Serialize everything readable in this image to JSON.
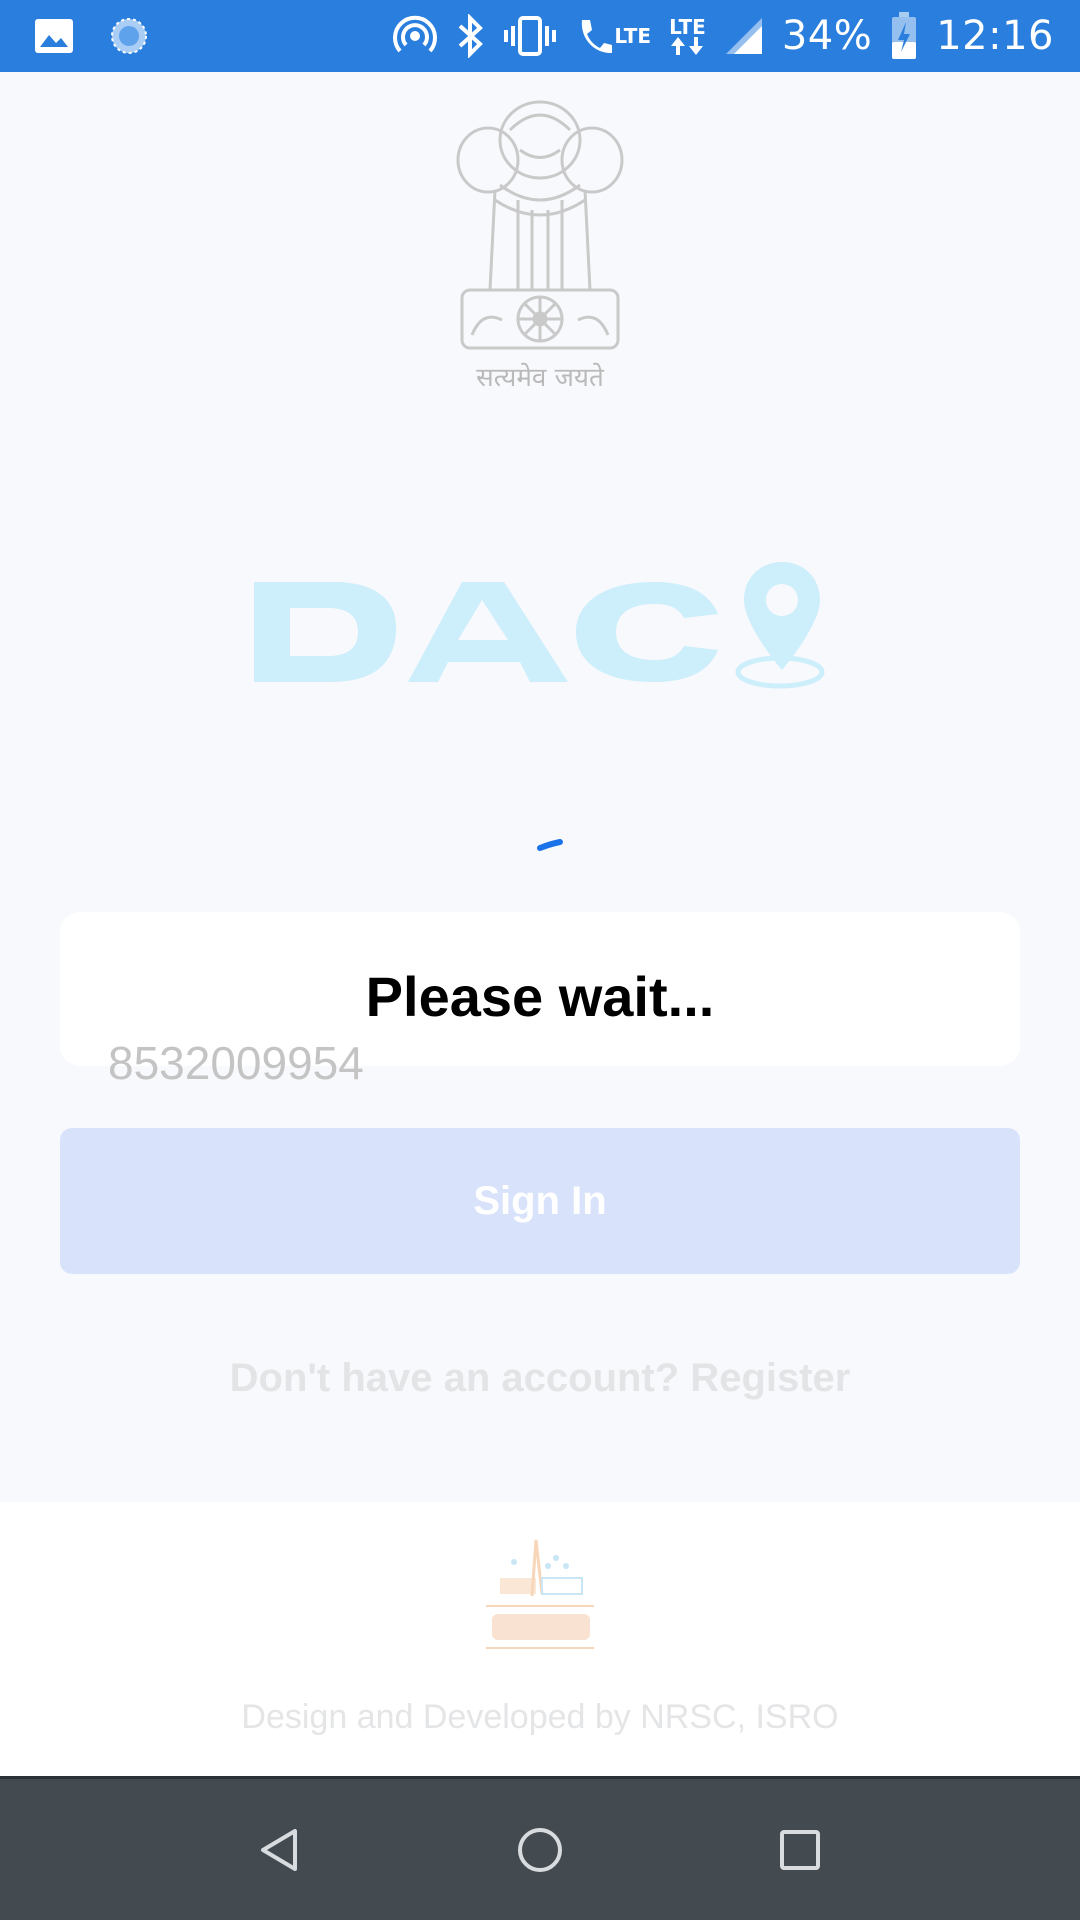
{
  "status_bar": {
    "battery": "34%",
    "time": "12:16",
    "lte_label_1": "LTE",
    "lte_label_2": "LTE",
    "icons": [
      "image-icon",
      "sync-icon",
      "hotspot-icon",
      "bluetooth-icon",
      "vibrate-icon",
      "volte-call-icon",
      "lte-data-icon",
      "signal-icon",
      "battery-icon"
    ]
  },
  "header": {
    "emblem_motto": "सत्यमेव जयते"
  },
  "loading": {
    "message": "Please wait..."
  },
  "login": {
    "phone_value": "8532009954",
    "signin_label": "Sign In",
    "register_text": "Don't have an account? Register"
  },
  "footer": {
    "credit": "Design and Developed by NRSC, ISRO"
  },
  "colors": {
    "status_bar": "#2a7fde",
    "brand_light_blue": "#cdeefb",
    "button_disabled": "#d8e3fb",
    "nav_bar": "#434a50",
    "spinner": "#1a73e8"
  }
}
